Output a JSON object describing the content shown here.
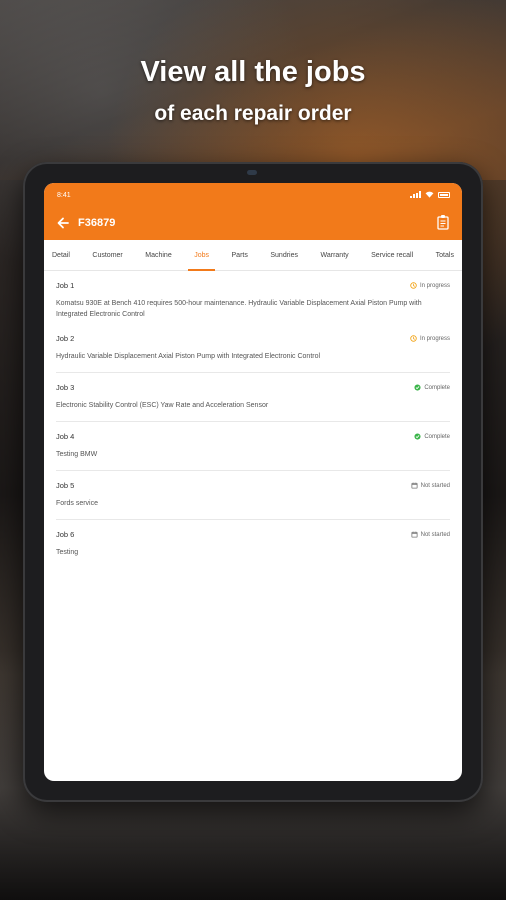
{
  "promo": {
    "headline": "View all the jobs",
    "subheadline": "of each repair order"
  },
  "statusbar": {
    "time": "8:41"
  },
  "toolbar": {
    "title": "F36879",
    "back_icon": "arrow-left-icon",
    "action_icon": "clipboard-icon"
  },
  "tabs": [
    {
      "label": "Detail"
    },
    {
      "label": "Customer"
    },
    {
      "label": "Machine"
    },
    {
      "label": "Jobs",
      "active": true
    },
    {
      "label": "Parts"
    },
    {
      "label": "Sundries"
    },
    {
      "label": "Warranty"
    },
    {
      "label": "Service recall"
    },
    {
      "label": "Totals"
    }
  ],
  "colors": {
    "accent": "#f27a1a",
    "in_progress": "#f2a51a",
    "complete": "#3bb54a",
    "not_started": "#777777"
  },
  "jobs": [
    {
      "title": "Job 1",
      "status": "In progress",
      "status_icon": "in-progress-icon",
      "description": "Komatsu 930E at Bench 410 requires 500-hour maintenance. Hydraulic Variable Displacement Axial Piston Pump with Integrated Electronic Control"
    },
    {
      "title": "Job 2",
      "status": "In progress",
      "status_icon": "in-progress-icon",
      "description": "Hydraulic Variable Displacement Axial Piston Pump with Integrated Electronic Control"
    },
    {
      "title": "Job 3",
      "status": "Complete",
      "status_icon": "check-circle-icon",
      "description": "Electronic Stability Control (ESC) Yaw Rate and Acceleration Sensor"
    },
    {
      "title": "Job 4",
      "status": "Complete",
      "status_icon": "check-circle-icon",
      "description": "Testing BMW"
    },
    {
      "title": "Job 5",
      "status": "Not started",
      "status_icon": "not-started-icon",
      "description": "Fords service"
    },
    {
      "title": "Job 6",
      "status": "Not started",
      "status_icon": "not-started-icon",
      "description": "Testing"
    }
  ]
}
